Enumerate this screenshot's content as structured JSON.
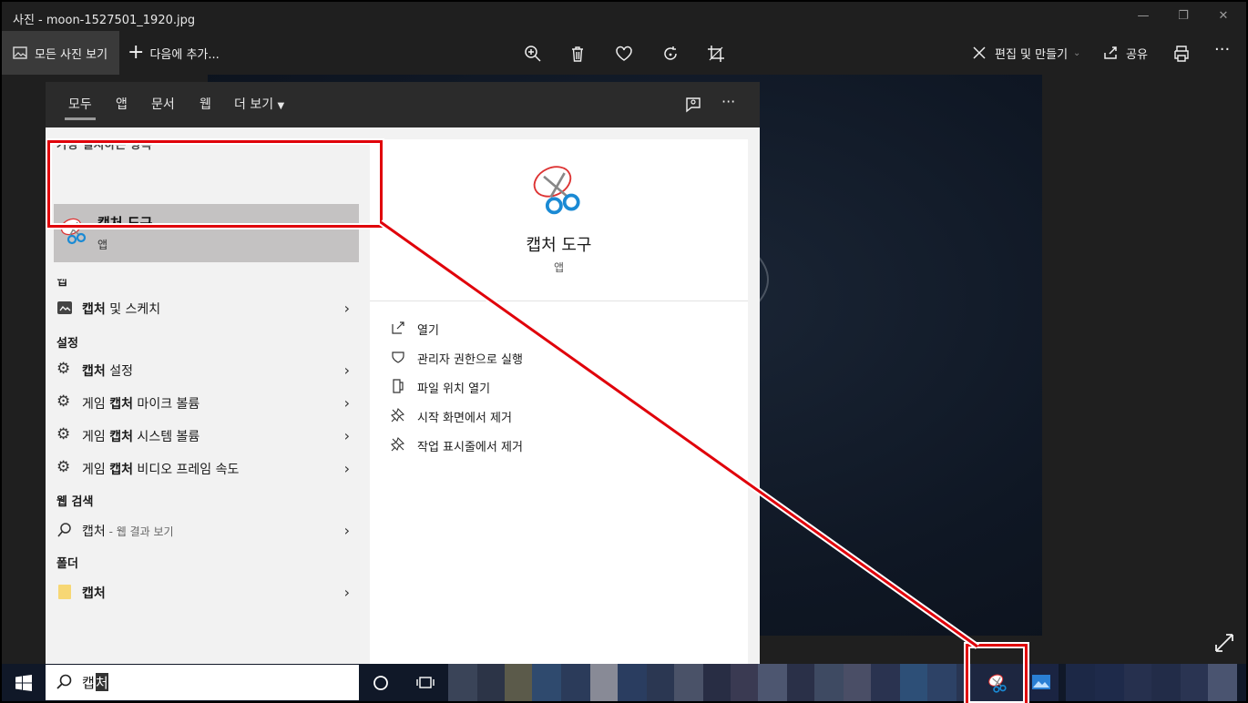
{
  "window": {
    "title": "사진 - moon-1527501_1920.jpg",
    "controls": [
      "—",
      "❐",
      "✕"
    ]
  },
  "toolbar": {
    "all_photos": "모든 사진 보기",
    "add_to": "다음에 추가...",
    "edit_create": "편집 및 만들기",
    "share": "공유"
  },
  "search_tabs": [
    "모두",
    "앱",
    "문서",
    "웹",
    "더 보기"
  ],
  "results": {
    "best_match_header": "가장 일치하는 항목",
    "best": {
      "name": "캡처 도구",
      "type": "앱"
    },
    "apps_header": "앱",
    "apps": [
      {
        "bold": "캡처",
        "rest": " 및 스케치"
      }
    ],
    "settings_header": "설정",
    "settings": [
      {
        "pre": "",
        "bold": "캡처",
        "rest": " 설정"
      },
      {
        "pre": "게임 ",
        "bold": "캡처",
        "rest": " 마이크 볼륨"
      },
      {
        "pre": "게임 ",
        "bold": "캡처",
        "rest": " 시스템 볼륨"
      },
      {
        "pre": "게임 ",
        "bold": "캡처",
        "rest": " 비디오 프레임 속도"
      }
    ],
    "web_header": "웹 검색",
    "web": {
      "term": "캡처",
      "suffix": " - 웹 결과 보기"
    },
    "folders_header": "폴더",
    "folders": [
      {
        "bold": "캡처"
      }
    ]
  },
  "preview": {
    "name": "캡처 도구",
    "type": "앱",
    "actions": [
      "열기",
      "관리자 권한으로 실행",
      "파일 위치 열기",
      "시작 화면에서 제거",
      "작업 표시줄에서 제거"
    ]
  },
  "taskbar": {
    "search_text_typed": "캡",
    "search_text_cursor": "처"
  },
  "colors": {
    "callout": "#e0000a",
    "taskbar": "#101828",
    "flyout_dark": "#2b2b2b"
  }
}
